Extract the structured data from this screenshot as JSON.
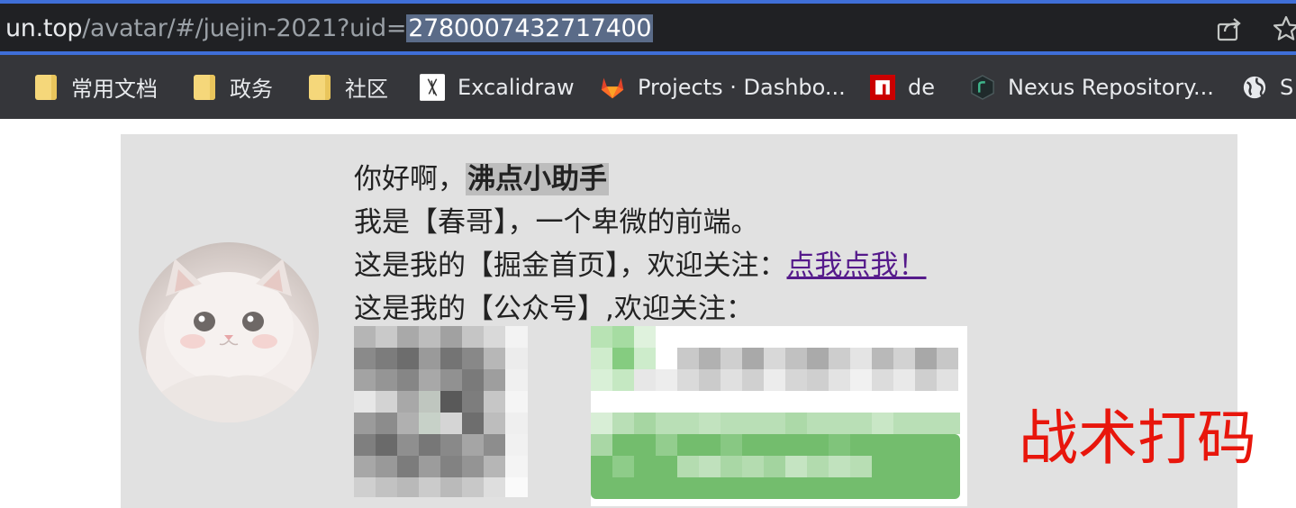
{
  "browser": {
    "url_host": "un.top",
    "url_path": "/avatar/#/juejin-2021?uid=",
    "url_selected": "2780007432717400",
    "share_icon": "share-icon",
    "star_icon": "star-icon",
    "accent_color": "#3f6fd8"
  },
  "bookmarks": [
    {
      "label": "常用文档",
      "icon": "folder-icon"
    },
    {
      "label": "政务",
      "icon": "folder-icon"
    },
    {
      "label": "社区",
      "icon": "folder-icon"
    },
    {
      "label": "Excalidraw",
      "icon": "excalidraw-icon"
    },
    {
      "label": "Projects · Dashbo...",
      "icon": "gitlab-icon"
    },
    {
      "label": "de",
      "icon": "npm-icon"
    },
    {
      "label": "Nexus Repository...",
      "icon": "nexus-icon"
    },
    {
      "label": "S",
      "icon": "globe-icon"
    }
  ],
  "content": {
    "greeting_prefix": "你好啊，",
    "greeting_name": "沸点小助手",
    "line2": "我是【春哥】，一个卑微的前端。",
    "line3_prefix": "这是我的【掘金首页】，欢迎关注：",
    "line3_link": "点我点我！",
    "line4": "这是我的【公众号】,欢迎关注：",
    "stamp": "战术打码"
  }
}
